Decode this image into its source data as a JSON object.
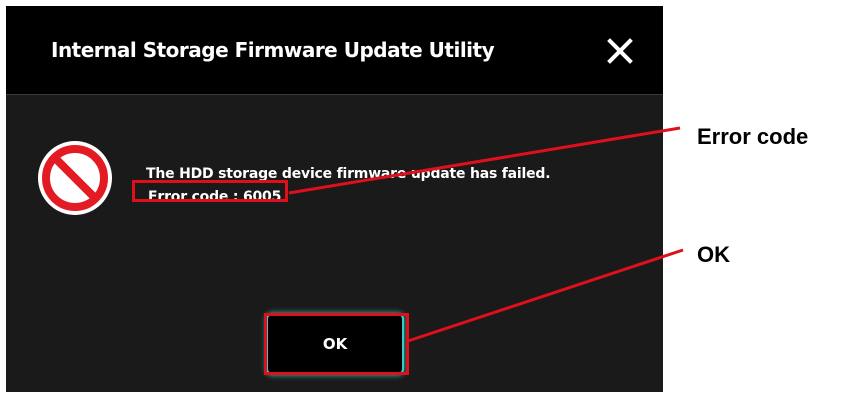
{
  "dialog": {
    "title": "Internal Storage Firmware Update Utility",
    "close_icon": "close-icon",
    "error_icon": "prohibited-icon",
    "message": "The HDD storage device firmware update has failed.",
    "error_code_text": "Error code : 6005",
    "ok_label": "OK"
  },
  "annotations": {
    "error_code_label": "Error code",
    "ok_label": "OK"
  },
  "colors": {
    "dialog_bg": "#1a1a1a",
    "title_bar_bg": "#000000",
    "highlight_red": "#e0101a",
    "button_glow": "#3ec7c7",
    "error_icon_red": "#e31b23"
  }
}
